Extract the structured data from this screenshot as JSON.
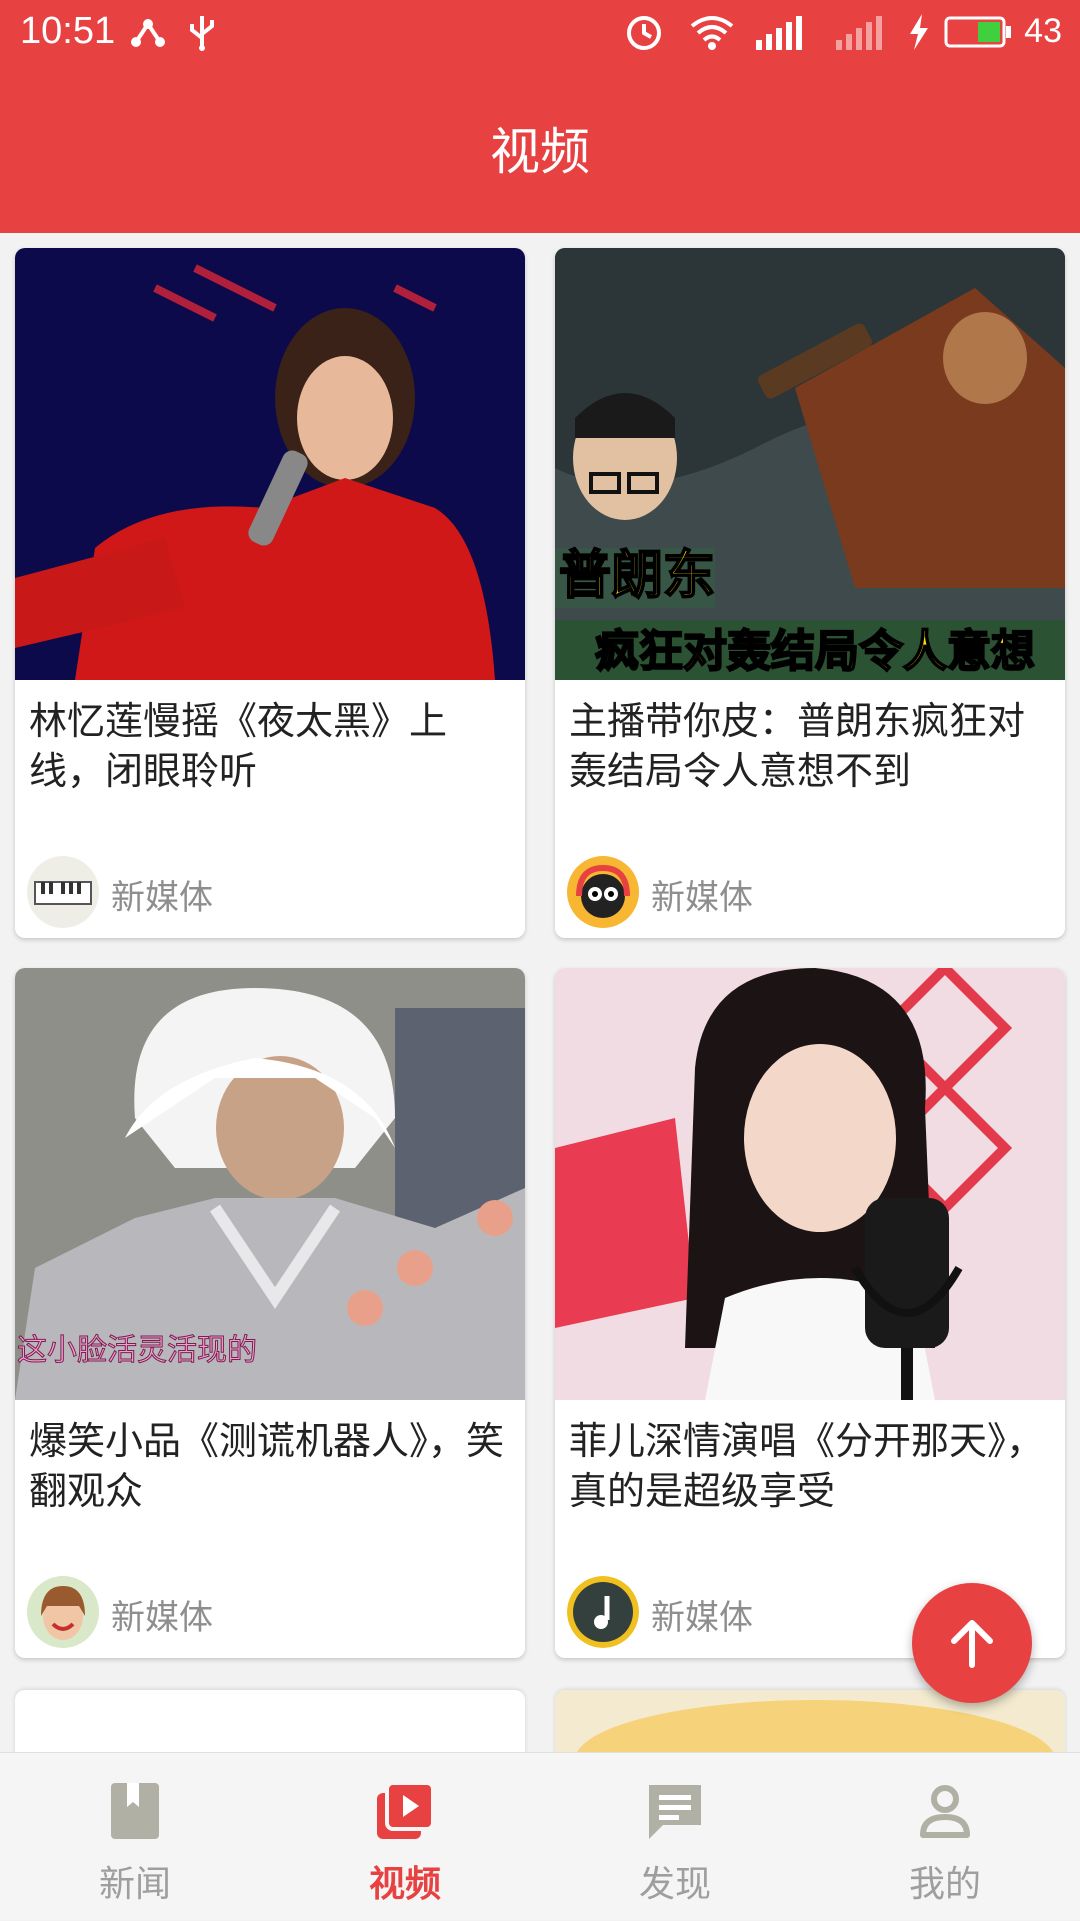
{
  "status_bar": {
    "time": "10:51",
    "battery": "43"
  },
  "header": {
    "title": "视频"
  },
  "colors": {
    "brand": "#e84142",
    "inactive": "#9e9e9e"
  },
  "videos": [
    {
      "title": "林忆莲慢摇《夜太黑》上线，闭眼聆听",
      "source": "新媒体",
      "avatar": "piano-avatar"
    },
    {
      "title": "主播带你皮：普朗东疯狂对轰结局令人意想不到",
      "source": "新媒体",
      "avatar": "cat-headphones-avatar",
      "thumb_caption_1": "普朗东",
      "thumb_caption_2": "疯狂对轰结局令人意想"
    },
    {
      "title": "爆笑小品《测谎机器人》，笑翻观众",
      "source": "新媒体",
      "avatar": "smiling-woman-avatar",
      "thumb_caption_1": "这小脸活灵活现的"
    },
    {
      "title": "菲儿深情演唱《分开那天》，真的是超级享受",
      "source": "新媒体",
      "avatar": "music-note-avatar"
    }
  ],
  "bottom_nav": [
    {
      "label": "新闻",
      "icon": "book-icon",
      "active": false
    },
    {
      "label": "视频",
      "icon": "video-icon",
      "active": true
    },
    {
      "label": "发现",
      "icon": "chat-icon",
      "active": false
    },
    {
      "label": "我的",
      "icon": "person-icon",
      "active": false
    }
  ]
}
